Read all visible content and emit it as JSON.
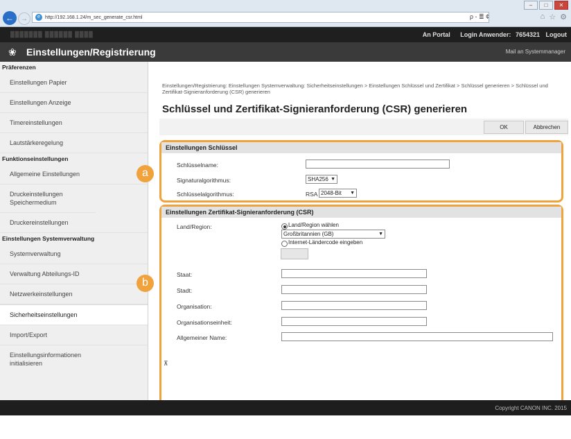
{
  "browser": {
    "url": "http://192.168.1.24/m_sec_generate_csr.html",
    "search_glyph": "ρ - ≣ ¢",
    "win_buttons": [
      "–",
      "□",
      "✕"
    ]
  },
  "portal": {
    "masked_left": "███████    ██████ ████",
    "portal_link": "An Portal",
    "login_label": "Login Anwender:",
    "login_id": "7654321",
    "logout": "Logout"
  },
  "header": {
    "title": "Einstellungen/Registrierung",
    "mail_link": "Mail an Systemmanager"
  },
  "sidebar": {
    "group1": "Präferenzen",
    "items1": [
      "Einstellungen Papier",
      "Einstellungen Anzeige",
      "Timereinstellungen",
      "Lautstärkeregelung"
    ],
    "group2": "Funktionseinstellungen",
    "items2": [
      "Allgemeine Einstellungen",
      "Druckeinstellungen Speichermedium",
      "Druckereinstellungen"
    ],
    "group3": "Einstellungen Systemverwaltung",
    "items3": [
      "Systemverwaltung",
      "Verwaltung Abteilungs-ID",
      "Netzwerkeinstellungen",
      "Sicherheitseinstellungen",
      "Import/Export",
      "Einstellungsinformationen initialisieren"
    ]
  },
  "main": {
    "breadcrumb": "Einstellungen/Registrierung: Einstellungen Systemverwaltung: Sicherheitseinstellungen > Einstellungen Schlüssel und Zertifikat > Schlüssel generieren > Schlüssel und Zertifikat-Signieranforderung (CSR) generieren",
    "title": "Schlüssel und Zertifikat-Signieranforderung (CSR) generieren",
    "ok": "OK",
    "cancel": "Abbrechen",
    "key_section": {
      "title": "Einstellungen Schlüssel",
      "name_label": "Schlüsselname:",
      "name_value": "",
      "sig_label": "Signaturalgorithmus:",
      "sig_value": "SHA256",
      "keyalg_label": "Schlüsselalgorithmus:",
      "keyalg_prefix": "RSA",
      "keyalg_value": "2048-Bit"
    },
    "csr_section": {
      "title": "Einstellungen Zertifikat-Signieranforderung (CSR)",
      "country_label": "Land/Region:",
      "radio1": "Land/Region wählen",
      "country_value": "Großbritannien (GB)",
      "radio2": "Internet-Ländercode eingeben",
      "state_label": "Staat:",
      "city_label": "Stadt:",
      "org_label": "Organisation:",
      "orgunit_label": "Organisationseinheit:",
      "cn_label": "Allgemeiner Name:"
    },
    "top_anchor": "⊼"
  },
  "badges": {
    "a": "a",
    "b": "b"
  },
  "footer": {
    "copyright": "Copyright CANON INC. 2015"
  },
  "colors": {
    "accent": "#f0a23c",
    "header": "#3a3a3a",
    "portal": "#1f1f1f"
  }
}
